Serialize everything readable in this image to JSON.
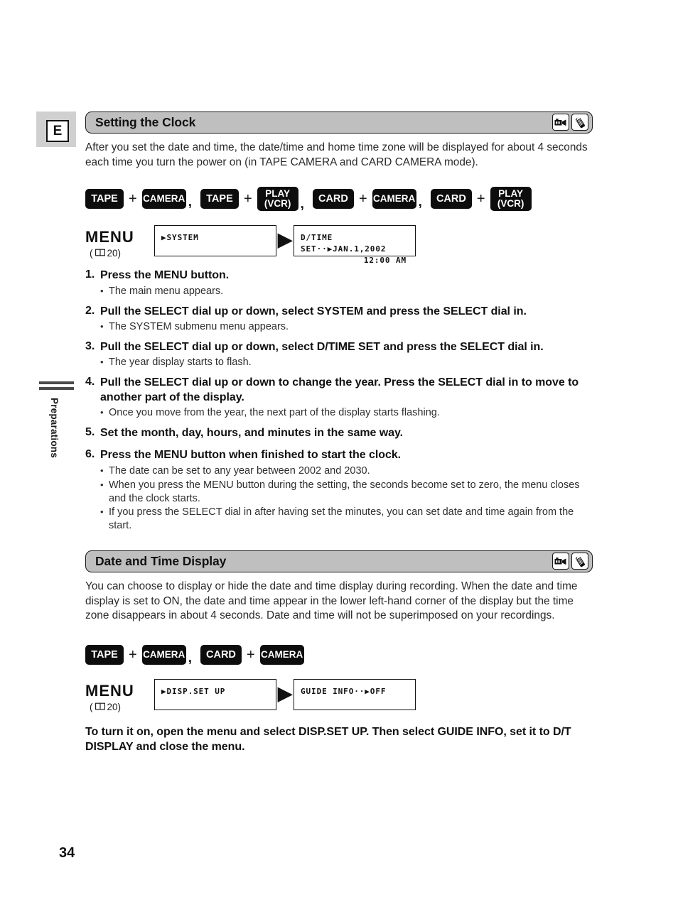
{
  "page": {
    "number": "34",
    "language_tab": "E",
    "side_label": "Preparations"
  },
  "sections": [
    {
      "id": "setting-the-clock",
      "title": "Setting the Clock",
      "icons": [
        "camcorder-icon",
        "memory-card-icon"
      ],
      "intro": "After you set the date and time, the date/time and home time zone will be displayed for about 4 seconds each time you turn the power on (in TAPE CAMERA and CARD CAMERA mode).",
      "mode_groups": [
        {
          "first": "TAPE",
          "plus": "+",
          "second": "CAMERA",
          "second_line2": "",
          "separator": ","
        },
        {
          "first": "TAPE",
          "plus": "+",
          "second": "PLAY",
          "second_line2": "(VCR)",
          "separator": ","
        },
        {
          "first": "CARD",
          "plus": "+",
          "second": "CAMERA",
          "second_line2": "",
          "separator": ","
        },
        {
          "first": "CARD",
          "plus": "+",
          "second": "PLAY",
          "second_line2": "(VCR)",
          "separator": ""
        }
      ],
      "menu_strip": {
        "menu_word": "MENU",
        "ref_prefix": "(",
        "ref_icon": "book-icon",
        "ref_page": "20)",
        "box_a_line1": "▶SYSTEM",
        "box_a_line2": "",
        "arrow": "▶",
        "box_b_line1": "D/TIME SET··▶JAN.1,2002",
        "box_b_line2": "12:00 AM"
      },
      "steps": [
        {
          "num": "1.",
          "text": "Press the MENU button.",
          "bullets": [
            "The main menu appears."
          ]
        },
        {
          "num": "2.",
          "text": "Pull the SELECT dial up or down, select SYSTEM and press the SELECT dial in.",
          "bullets": [
            "The SYSTEM submenu menu appears."
          ]
        },
        {
          "num": "3.",
          "text": "Pull the SELECT dial up or down, select D/TIME SET and press the SELECT dial in.",
          "bullets": [
            "The year display starts to flash."
          ]
        },
        {
          "num": "4.",
          "text": "Pull the SELECT dial up or down to change the year. Press the SELECT dial in to move to another part of the display.",
          "bullets": [
            "Once you move from the year, the next part of the display starts flashing."
          ]
        },
        {
          "num": "5.",
          "text": "Set the month, day, hours, and minutes in the same way.",
          "bullets": []
        },
        {
          "num": "6.",
          "text": "Press the MENU button when finished to start the clock.",
          "bullets": [
            "The date can be set to any year between 2002 and 2030.",
            "When you press the MENU button during the setting, the seconds become set to zero, the menu closes and the clock starts.",
            "If you press the SELECT dial in after having set the minutes, you can set date and time again from the start."
          ]
        }
      ]
    },
    {
      "id": "date-and-time-display",
      "title": "Date and Time Display",
      "icons": [
        "camcorder-icon",
        "memory-card-icon"
      ],
      "intro": "You can choose to display or hide the date and time display during recording. When the date and time display is set to ON, the date and time appear in the lower left-hand corner of the display but the time zone disappears in about 4 seconds. Date and time will not be superimposed on your recordings.",
      "mode_groups": [
        {
          "first": "TAPE",
          "plus": "+",
          "second": "CAMERA",
          "second_line2": "",
          "separator": ","
        },
        {
          "first": "CARD",
          "plus": "+",
          "second": "CAMERA",
          "second_line2": "",
          "separator": ""
        }
      ],
      "menu_strip": {
        "menu_word": "MENU",
        "ref_prefix": "(",
        "ref_icon": "book-icon",
        "ref_page": "20)",
        "box_a_line1": "▶DISP.SET UP",
        "box_a_line2": "",
        "arrow": "▶",
        "box_b_line1": "GUIDE INFO··▶OFF",
        "box_b_line2": ""
      },
      "closing_note": "To turn it on, open the menu and select DISP.SET UP. Then select GUIDE INFO, set it to D/T DISPLAY and close the menu."
    }
  ],
  "colors": {
    "bar_background": "#bfbfbf",
    "tab_background": "#d0d0d0",
    "button_background": "#0d0d0d",
    "ink": "#111111"
  }
}
